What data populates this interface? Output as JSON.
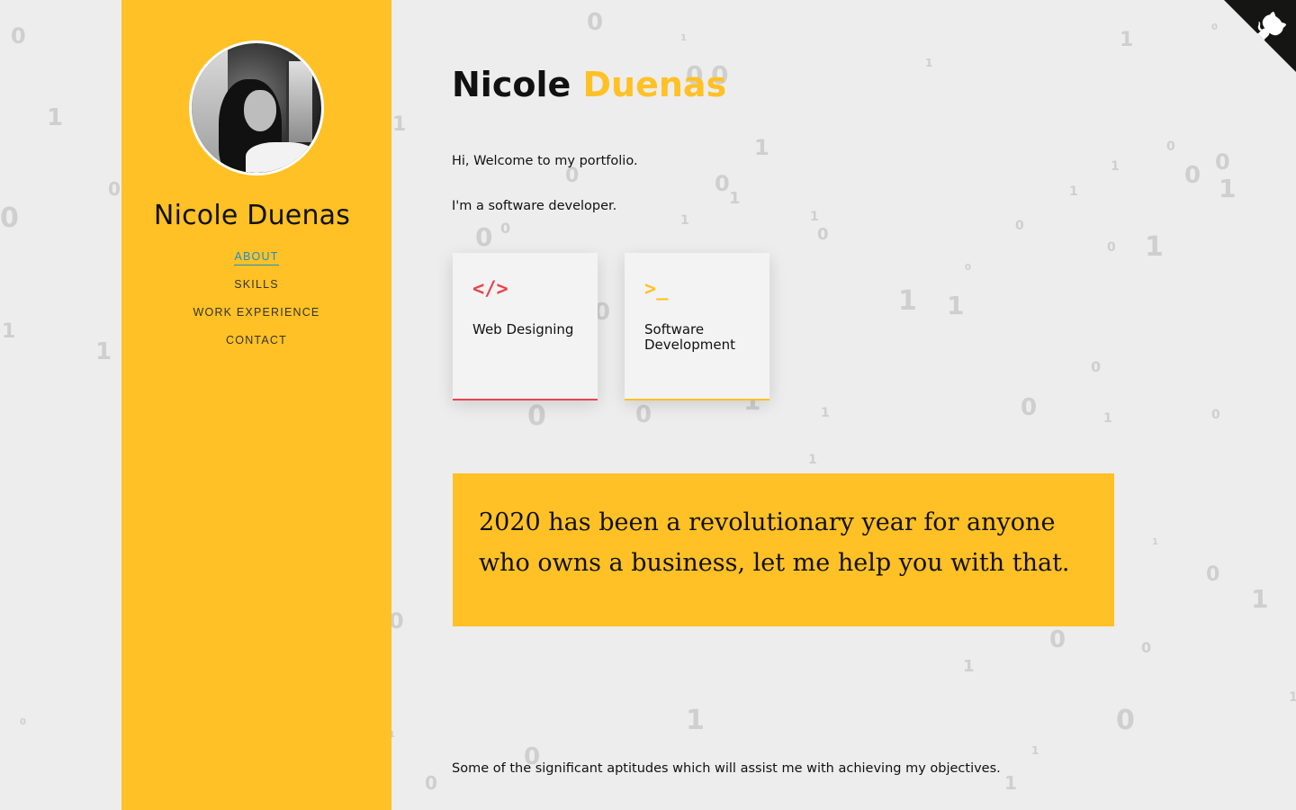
{
  "sidebar": {
    "name": "Nicole Duenas",
    "nav": [
      {
        "label": "ABOUT",
        "active": true
      },
      {
        "label": "SKILLS",
        "active": false
      },
      {
        "label": "WORK EXPERIENCE",
        "active": false
      },
      {
        "label": "CONTACT",
        "active": false
      }
    ],
    "background_color": "#ffc125"
  },
  "header": {
    "first_name": "Nicole",
    "last_name": "Duenas"
  },
  "intro": {
    "line1": "Hi, Welcome to my portfolio.",
    "line2": "I'm a software developer."
  },
  "cards": [
    {
      "icon": "code-icon",
      "glyph": "</>",
      "label": "Web Designing",
      "accent": "#e8454f"
    },
    {
      "icon": "terminal-icon",
      "glyph": ">_",
      "label": "Software Development",
      "accent": "#ffc125"
    }
  ],
  "quote": {
    "text": "2020 has been a revolutionary year for anyone who owns a business, let me help you with that."
  },
  "aptitudes": {
    "text": "Some of the significant aptitudes which will assist me with achieving my objectives."
  },
  "background_digits": [
    "0",
    "1",
    "0",
    "0",
    "1",
    "1",
    "0",
    "1",
    "0",
    "0",
    "1",
    "0",
    "1",
    "0",
    "1",
    "1",
    "0",
    "0",
    "1",
    "0",
    "1",
    "1",
    "0",
    "0",
    "1",
    "0",
    "0",
    "1",
    "1",
    "0",
    "0",
    "1",
    "0",
    "1",
    "1",
    "0",
    "0",
    "1",
    "0",
    "0",
    "1",
    "1",
    "0",
    "1",
    "0",
    "0",
    "1",
    "1"
  ],
  "github_corner": {
    "icon": "github-octocat-icon",
    "color": "#151513"
  }
}
